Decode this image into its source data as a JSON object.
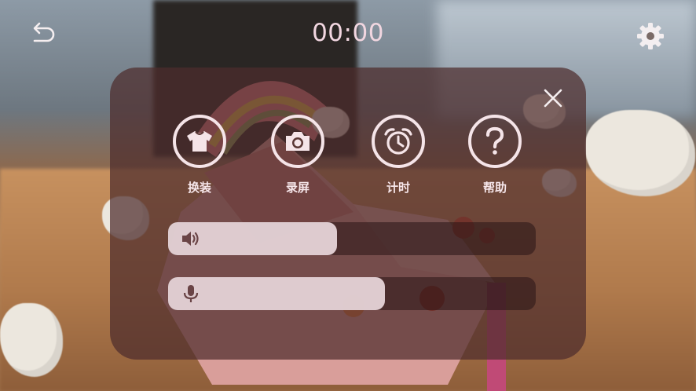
{
  "top_bar": {
    "timer": "00:00",
    "back_icon": "undo-arrow-icon",
    "settings_icon": "gear-icon"
  },
  "panel": {
    "close_icon": "close-icon",
    "actions": [
      {
        "label": "换装",
        "icon": "tshirt-icon"
      },
      {
        "label": "录屏",
        "icon": "camera-icon"
      },
      {
        "label": "计时",
        "icon": "alarm-clock-icon"
      },
      {
        "label": "帮助",
        "icon": "question-icon"
      }
    ],
    "sliders": [
      {
        "icon": "speaker-icon",
        "level": 0.46
      },
      {
        "icon": "microphone-icon",
        "level": 0.59
      }
    ]
  },
  "colors": {
    "panel_bg": "#4e2c2c",
    "accent_light": "#f5e4e8",
    "timer_text": "#f1d6e0"
  }
}
